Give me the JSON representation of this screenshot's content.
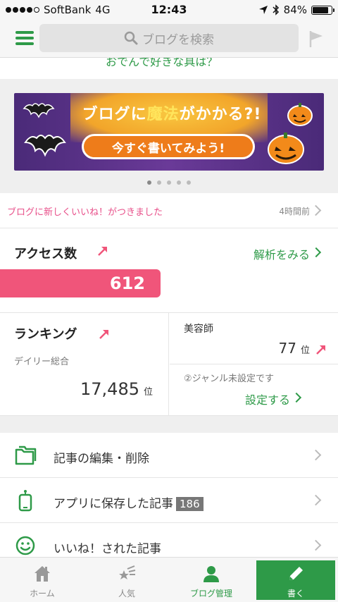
{
  "status_bar": {
    "carrier": "SoftBank",
    "network": "4G",
    "time": "12:43",
    "battery_percent": "84%",
    "battery_level": 0.84
  },
  "header": {
    "search_placeholder": "ブログを検索"
  },
  "scrolled_text": "おでんで好きな具は？",
  "banner": {
    "title_part1": "ブログに",
    "title_part2": "魔法",
    "title_part3": "がかかる?!",
    "cta": "今すぐ書いてみよう!",
    "page_count": 5,
    "active_page": 0
  },
  "notification": {
    "message": "ブログに新しくいいね！がつきました",
    "time": "4時間前"
  },
  "access": {
    "label": "アクセス数",
    "analyze_link": "解析をみる",
    "value": "612"
  },
  "ranking": {
    "label": "ランキング",
    "sub_label": "デイリー総合",
    "overall_rank": "17,485",
    "rank_unit": "位",
    "genre1_name": "美容師",
    "genre1_rank": "77",
    "genre2_name": "②ジャンル未設定です",
    "set_link": "設定する"
  },
  "menu": {
    "items": [
      {
        "label": "記事の編集・削除",
        "icon": "folder-icon"
      },
      {
        "label": "アプリに保存した記事",
        "badge": "186",
        "icon": "phone-icon"
      },
      {
        "label": "いいね！された記事",
        "icon": "smile-icon"
      }
    ]
  },
  "tabbar": {
    "home": "ホーム",
    "popular": "人気",
    "blog_manage": "ブログ管理",
    "write": "書く"
  },
  "colors": {
    "accent_green": "#2e9a48",
    "pink": "#f0557a"
  }
}
